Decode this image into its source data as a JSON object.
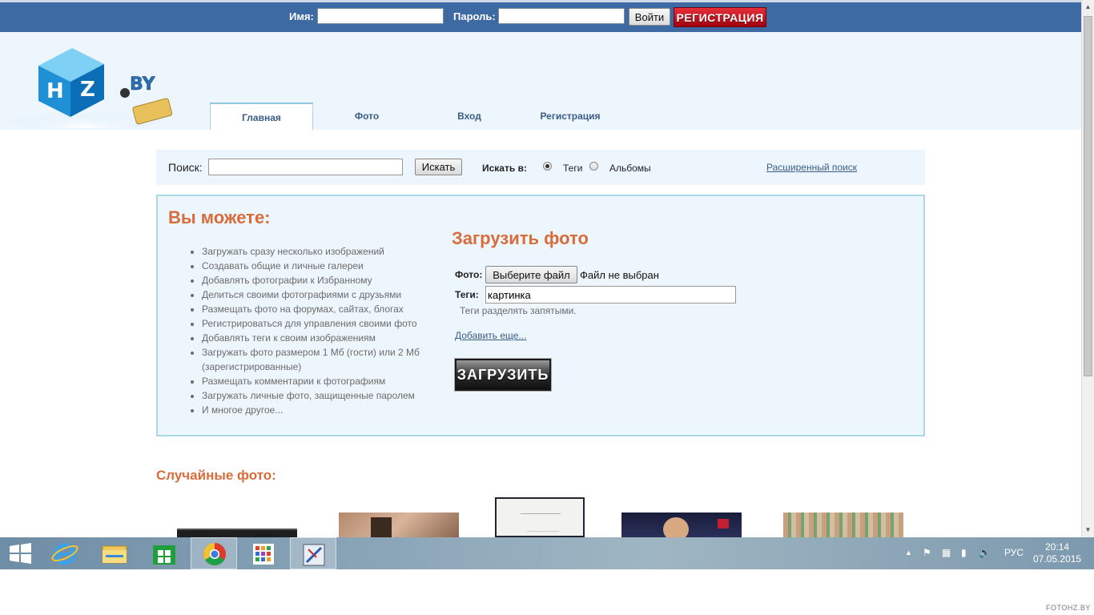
{
  "topbar": {
    "name_label": "Имя:",
    "password_label": "Пароль:",
    "login_button": "Войти",
    "register_button": "РЕГИСТРАЦИЯ"
  },
  "nav": {
    "tabs": [
      {
        "label": "Главная",
        "active": true
      },
      {
        "label": "Фото",
        "active": false
      },
      {
        "label": "Вход",
        "active": false
      },
      {
        "label": "Регистрация",
        "active": false
      }
    ]
  },
  "search": {
    "label": "Поиск:",
    "button": "Искать",
    "in_label": "Искать в:",
    "options": [
      {
        "label": "Теги",
        "checked": true
      },
      {
        "label": "Альбомы",
        "checked": false
      }
    ],
    "advanced_link": "Расширенный поиск"
  },
  "features": {
    "title": "Вы можете:",
    "items": [
      "Загружать сразу несколько изображений",
      "Создавать общие и личные галереи",
      "Добавлять фотографии к Избранному",
      "Делиться своими фотографиями с друзьями",
      "Размещать фото на форумах, сайтах, блогах",
      "Регистрироваться для управления своими фото",
      "Добавлять теги к своим изображениям",
      "Загружать фото размером 1 Мб (гости) или 2 Мб (зарегистрированные)",
      "Размещать комментарии к фотографиям",
      "Загружать личные фото, защищенные паролем",
      "И многое другое..."
    ]
  },
  "upload": {
    "title": "Загрузить фото",
    "photo_label": "Фото:",
    "file_button": "Выберите файл",
    "file_status": "Файл не выбран",
    "tags_label": "Теги:",
    "tags_value": "картинка",
    "tags_hint": "Теги разделять запятыми.",
    "add_more_link": "Добавить еще...",
    "submit_button": "ЗАГРУЗИТЬ"
  },
  "random": {
    "title": "Случайные фото:"
  },
  "taskbar": {
    "language": "РУС",
    "time": "20:14",
    "date": "07.05.2015"
  },
  "watermark": "FOTOHZ.BY",
  "colors": {
    "topbar": "#3e6aa3",
    "header_bg": "#eef6fd",
    "accent_orange": "#d86c3a",
    "link": "#3a5d86",
    "register_red": "#c8101a"
  }
}
